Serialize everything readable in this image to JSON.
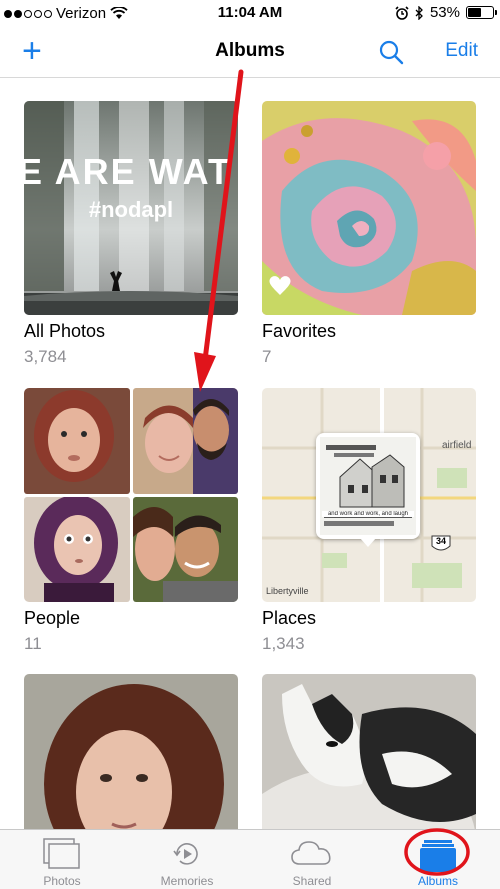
{
  "status_bar": {
    "carrier": "Verizon",
    "time": "11:04 AM",
    "battery": "53%",
    "battery_level": 0.53
  },
  "nav": {
    "add_label": "+",
    "title": "Albums",
    "edit_label": "Edit"
  },
  "albums": [
    {
      "name": "All Photos",
      "count": "3,784",
      "overlay_line1": "E ARE WAT",
      "overlay_line2": "#nodapl"
    },
    {
      "name": "Favorites",
      "count": "7"
    },
    {
      "name": "People",
      "count": "11"
    },
    {
      "name": "Places",
      "count": "1,343",
      "map_label_town": "Libertyville",
      "map_label_city": "airfield",
      "map_route": "34",
      "pin_caption": "and work and work, and laugh"
    },
    {
      "name": "",
      "count": ""
    },
    {
      "name": "",
      "count": ""
    }
  ],
  "tabs": [
    {
      "label": "Photos"
    },
    {
      "label": "Memories"
    },
    {
      "label": "Shared"
    },
    {
      "label": "Albums"
    }
  ],
  "colors": {
    "accent": "#1a7ee8",
    "annotation_red": "#e0141b"
  }
}
